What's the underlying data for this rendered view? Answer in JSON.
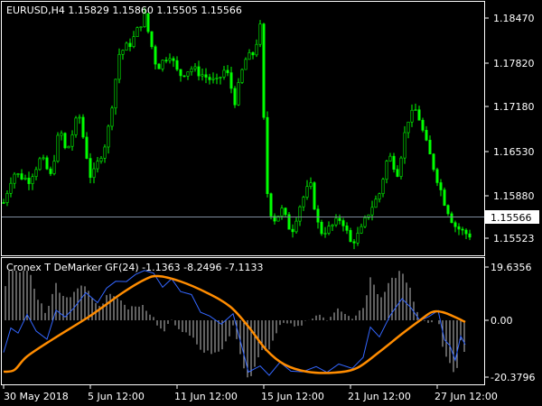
{
  "main_chart": {
    "symbol_info": "EURUSD,H4  1.15829 1.15860 1.15505 1.15566",
    "price_labels": [
      "1.18470",
      "1.17820",
      "1.17180",
      "1.16530",
      "1.15880",
      "1.15523"
    ],
    "current_price": "1.15566",
    "colors": {
      "candle": "#00ff00",
      "price_line": "#7f8c9e",
      "background": "#000000"
    }
  },
  "indicator": {
    "title": "Cronex T DeMarker GF(24) -1.1363 -8.2496 -7.1133",
    "labels": [
      "19.6356",
      "0.00",
      "-20.3796"
    ],
    "colors": {
      "fast_line": "#3366ff",
      "slow_line": "#ff8c00",
      "histogram": "#c0c0c0"
    }
  },
  "time_axis": {
    "labels": [
      "30 May 2018",
      "5 Jun 12:00",
      "11 Jun 12:00",
      "15 Jun 12:00",
      "21 Jun 12:00",
      "27 Jun 12:00"
    ]
  },
  "chart_data": {
    "type": "candlestick",
    "series": [
      {
        "name": "EURUSD,H4",
        "type": "candlestick"
      },
      {
        "name": "Cronex T DeMarker GF(24)",
        "type": "line"
      }
    ],
    "x": [
      "30 May 2018",
      "5 Jun 12:00",
      "11 Jun 12:00",
      "15 Jun 12:00",
      "21 Jun 12:00",
      "27 Jun 12:00"
    ],
    "y_ticks": [
      1.1847,
      1.1782,
      1.1718,
      1.1653,
      1.1588,
      1.15523
    ],
    "ylim": [
      1.1505,
      1.1875
    ],
    "close_approx": [
      1.163,
      1.167,
      1.176,
      1.183,
      1.179,
      1.1795,
      1.176,
      1.183,
      1.1705,
      1.158,
      1.1565,
      1.157,
      1.161,
      1.159,
      1.164,
      1.1665,
      1.171,
      1.164,
      1.1565,
      1.1565,
      1.15566
    ],
    "last_close": 1.15566,
    "indicator": {
      "ylim": [
        -20.3796,
        19.6356
      ],
      "last_values": [
        -1.1363,
        -8.2496,
        -7.1133
      ]
    }
  }
}
